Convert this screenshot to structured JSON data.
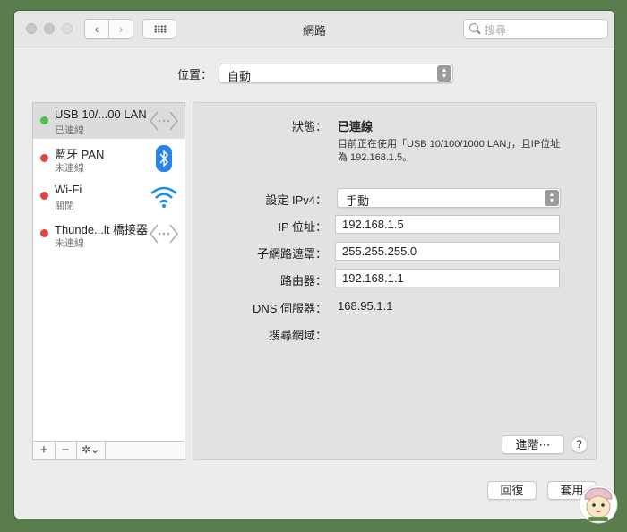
{
  "window": {
    "title": "網路"
  },
  "toolbar": {
    "back_glyph": "‹",
    "forward_glyph": "›",
    "search_placeholder": "搜尋"
  },
  "location": {
    "label": "位置：",
    "value": "自動"
  },
  "services": [
    {
      "name": "USB 10/...00 LAN",
      "status": "已連線",
      "dot_color": "#4cc14c",
      "icon": "ethernet-icon",
      "selected": true
    },
    {
      "name": "藍牙 PAN",
      "status": "未連線",
      "dot_color": "#e0443e",
      "icon": "bluetooth-icon"
    },
    {
      "name": "Wi-Fi",
      "status": "關閉",
      "dot_color": "#e0443e",
      "icon": "wifi-icon"
    },
    {
      "name": "Thunde...lt 橋接器",
      "status": "未連線",
      "dot_color": "#e0443e",
      "icon": "thunderbolt-bridge-icon"
    }
  ],
  "sidebar_buttons": {
    "add": "+",
    "remove": "−",
    "action": "✲⌄"
  },
  "detail": {
    "status_label": "狀態：",
    "status_value": "已連線",
    "status_desc": "目前正在使用「USB 10/100/1000 LAN」，且IP位址為 192.168.1.5。",
    "ipv4_label": "設定 IPv4：",
    "ipv4_value": "手動",
    "ip_label": "IP 位址：",
    "ip_value": "192.168.1.5",
    "subnet_label": "子網路遮罩：",
    "subnet_value": "255.255.255.0",
    "router_label": "路由器：",
    "router_value": "192.168.1.1",
    "dns_label": "DNS 伺服器：",
    "dns_value": "168.95.1.1",
    "search_domains_label": "搜尋網域：",
    "advanced_label": "進階⋯",
    "help_label": "?"
  },
  "footer": {
    "revert_label": "回復",
    "apply_label": "套用"
  },
  "colors": {
    "accent_blue": "#1a8ef0",
    "bluetooth_blue": "#2a84e8",
    "status_green": "#4cc14c",
    "status_red": "#e0443e"
  }
}
